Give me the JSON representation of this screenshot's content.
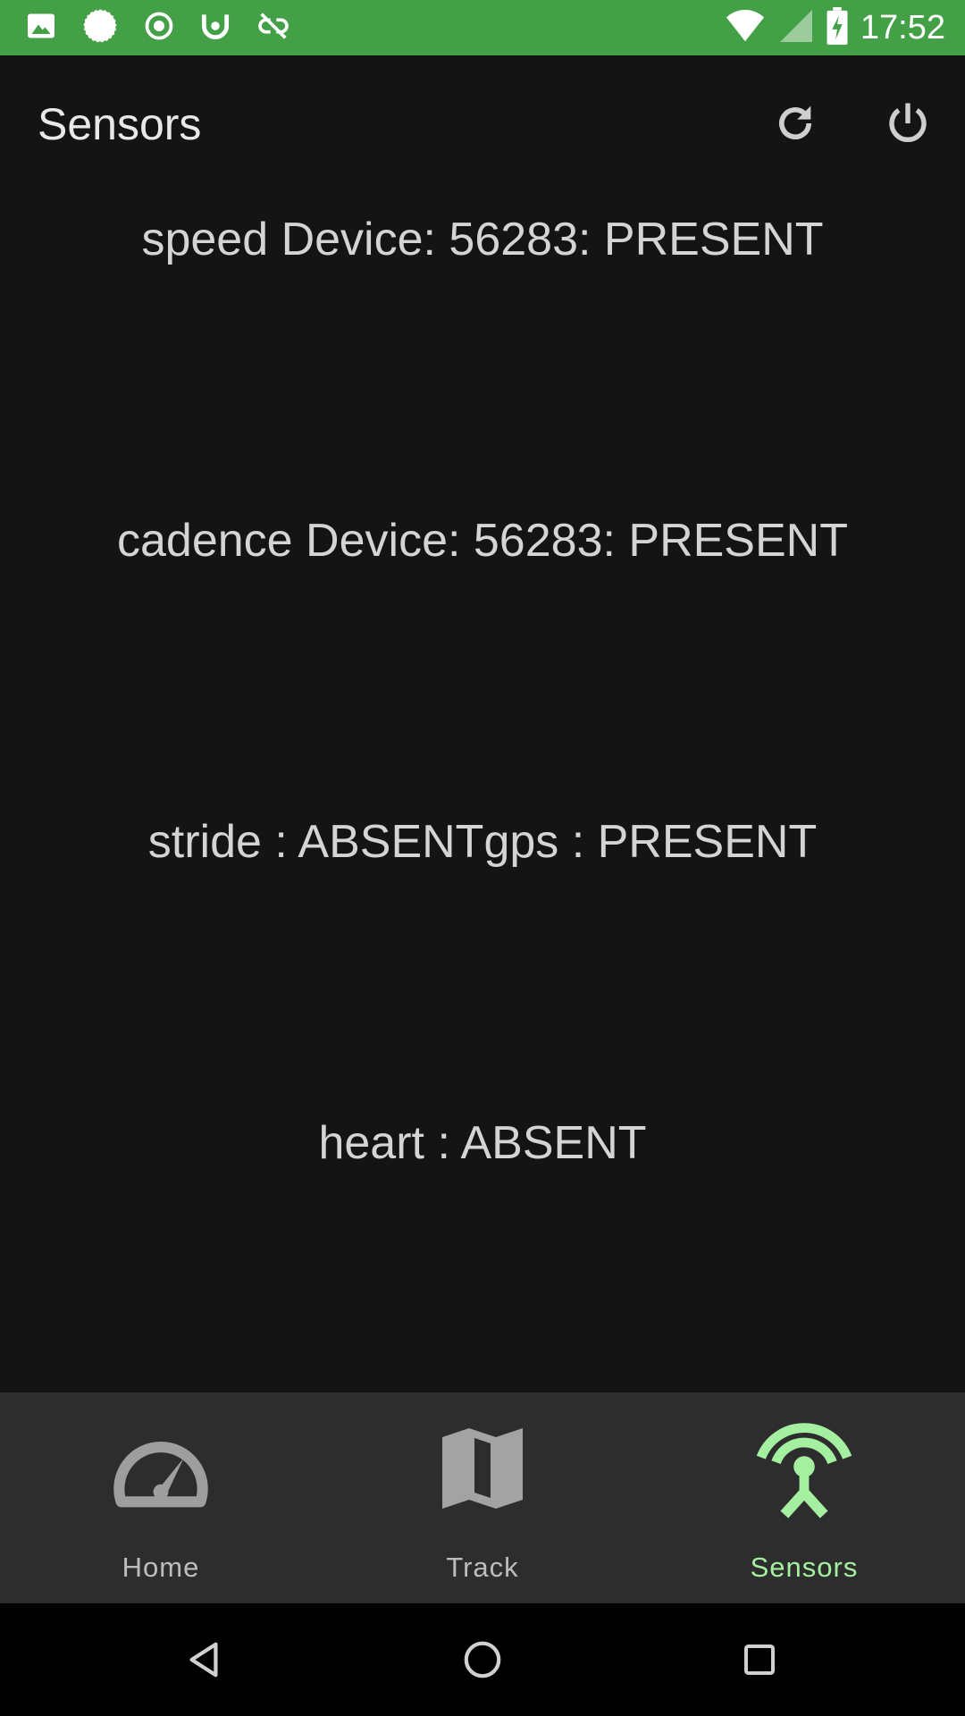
{
  "status_bar": {
    "time": "17:52",
    "color": "#43a047",
    "left_icons": [
      "image-icon",
      "spinner-icon",
      "record-icon",
      "tracker-icon",
      "link-off-icon"
    ],
    "right_icons": [
      "wifi-icon",
      "signal-icon",
      "battery-icon"
    ]
  },
  "app_bar": {
    "title": "Sensors",
    "actions": [
      "refresh-icon",
      "power-icon"
    ]
  },
  "sensors": [
    "speed Device: 56283: PRESENT",
    "cadence Device: 56283: PRESENT",
    "stride : ABSENTgps : PRESENT",
    "heart : ABSENT"
  ],
  "bottom_nav": {
    "items": [
      {
        "label": "Home",
        "icon": "speedometer-icon"
      },
      {
        "label": "Track",
        "icon": "map-icon"
      },
      {
        "label": "Sensors",
        "icon": "antenna-icon",
        "active": true
      }
    ],
    "active_color": "#a5f0a0"
  },
  "system_nav": [
    "back-icon",
    "home-icon",
    "recents-icon"
  ]
}
